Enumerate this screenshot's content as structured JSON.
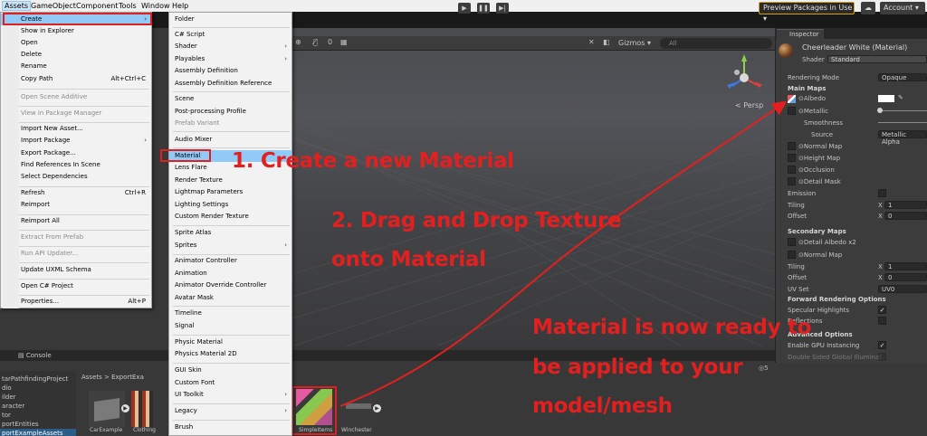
{
  "menubar": {
    "items": [
      "Assets",
      "GameObject",
      "Component",
      "Tools",
      "Window",
      "Help"
    ]
  },
  "toolbar": {
    "play_icon": "play-icon",
    "pause_icon": "pause-icon",
    "step_icon": "step-icon",
    "preview_packages": "Preview Packages in Use",
    "account": "Account"
  },
  "assets_menu": [
    {
      "label": "Create",
      "arrow": true,
      "highlighted": true
    },
    {
      "label": "Show in Explorer"
    },
    {
      "label": "Open"
    },
    {
      "label": "Delete"
    },
    {
      "label": "Rename"
    },
    {
      "label": "Copy Path",
      "shortcut": "Alt+Ctrl+C"
    },
    {
      "label": "Open Scene Additive",
      "disabled": true
    },
    {
      "label": "View in Package Manager",
      "disabled": true
    },
    {
      "label": "Import New Asset..."
    },
    {
      "label": "Import Package",
      "arrow": true
    },
    {
      "label": "Export Package..."
    },
    {
      "label": "Find References In Scene"
    },
    {
      "label": "Select Dependencies"
    },
    {
      "label": "Refresh",
      "shortcut": "Ctrl+R"
    },
    {
      "label": "Reimport"
    },
    {
      "label": "Reimport All"
    },
    {
      "label": "Extract From Prefab",
      "disabled": true
    },
    {
      "label": "Run API Updater...",
      "disabled": true
    },
    {
      "label": "Update UXML Schema"
    },
    {
      "label": "Open C# Project"
    },
    {
      "label": "Properties...",
      "shortcut": "Alt+P"
    }
  ],
  "create_menu": [
    {
      "label": "Folder"
    },
    {
      "label": "C# Script"
    },
    {
      "label": "Shader",
      "arrow": true
    },
    {
      "label": "Playables",
      "arrow": true
    },
    {
      "label": "Assembly Definition"
    },
    {
      "label": "Assembly Definition Reference"
    },
    {
      "label": "Scene"
    },
    {
      "label": "Post-processing Profile"
    },
    {
      "label": "Prefab Variant",
      "disabled": true
    },
    {
      "label": "Audio Mixer"
    },
    {
      "label": "Material",
      "highlighted": true
    },
    {
      "label": "Lens Flare"
    },
    {
      "label": "Render Texture"
    },
    {
      "label": "Lightmap Parameters"
    },
    {
      "label": "Lighting Settings"
    },
    {
      "label": "Custom Render Texture"
    },
    {
      "label": "Sprite Atlas"
    },
    {
      "label": "Sprites",
      "arrow": true
    },
    {
      "label": "Animator Controller"
    },
    {
      "label": "Animation"
    },
    {
      "label": "Animator Override Controller"
    },
    {
      "label": "Avatar Mask"
    },
    {
      "label": "Timeline"
    },
    {
      "label": "Signal"
    },
    {
      "label": "Physic Material"
    },
    {
      "label": "Physics Material 2D"
    },
    {
      "label": "GUI Skin"
    },
    {
      "label": "Custom Font"
    },
    {
      "label": "UI Toolkit",
      "arrow": true
    },
    {
      "label": "Legacy",
      "arrow": true
    },
    {
      "label": "Brush"
    }
  ],
  "scene": {
    "gizmos": "Gizmos",
    "search_placeholder": "All",
    "persp": "< Persp",
    "hidden_count": "0"
  },
  "inspector": {
    "tab": "Inspector",
    "material_name": "Cheerleader White (Material)",
    "shader_label": "Shader",
    "shader_value": "Standard",
    "rendering_mode_label": "Rendering Mode",
    "rendering_mode_value": "Opaque",
    "main_maps": "Main Maps",
    "albedo": "Albedo",
    "metallic": "Metallic",
    "smoothness": "Smoothness",
    "source": "Source",
    "source_value": "Metallic Alpha",
    "normal_map": "Normal Map",
    "height_map": "Height Map",
    "occlusion": "Occlusion",
    "detail_mask": "Detail Mask",
    "emission": "Emission",
    "tiling": "Tiling",
    "offset": "Offset",
    "x": "X",
    "tiling_x": "1",
    "offset_x": "0",
    "secondary_maps": "Secondary Maps",
    "detail_albedo": "Detail Albedo x2",
    "normal_map2": "Normal Map",
    "tiling2_x": "1",
    "offset2_x": "0",
    "uv_set": "UV Set",
    "uv_set_value": "UV0",
    "forward_options": "Forward Rendering Options",
    "specular_highlights": "Specular Highlights",
    "reflections": "Reflections",
    "advanced_options": "Advanced Options",
    "enable_gpu_instancing": "Enable GPU Instancing",
    "double_sided_gi": "Double Sided Global Illuminat"
  },
  "project": {
    "console_tab": "Console",
    "breadcrumb": "Assets > ExportExa",
    "tree": [
      "tarPathfindingProject",
      "dio",
      "ilder",
      "aracter",
      "tor",
      "portEntities",
      "portExampleAssets"
    ],
    "assets": [
      {
        "label": "CarExample"
      },
      {
        "label": "Clothing"
      },
      {
        "label": "SimpleItems"
      },
      {
        "label": "Winchester"
      }
    ],
    "count": "5"
  },
  "annotations": {
    "step1": "1. Create a new Material",
    "step2_line1": "2. Drag and Drop Texture",
    "step2_line2": "onto Material",
    "step3_line1": "Material is now ready to",
    "step3_line2": "be applied to your",
    "step3_line3": "model/mesh"
  },
  "colors": {
    "annotation_red": "#e3201f",
    "menu_highlight": "#91c9f7",
    "unity_dark": "#383838"
  }
}
